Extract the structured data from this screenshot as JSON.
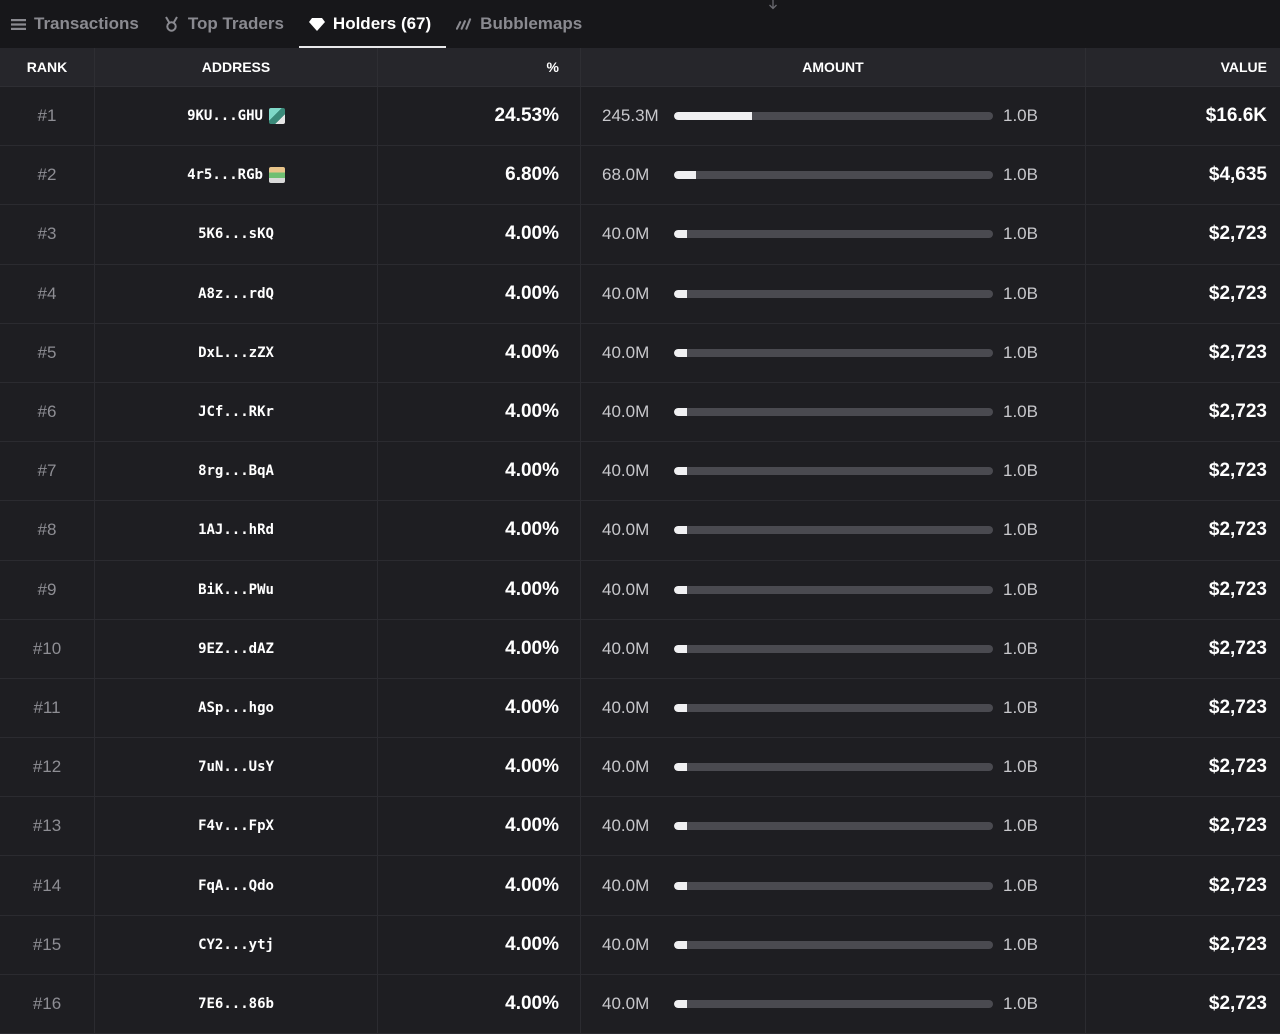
{
  "tabs": [
    {
      "label": "Transactions",
      "icon": "list-icon",
      "active": false
    },
    {
      "label": "Top Traders",
      "icon": "medal-icon",
      "active": false
    },
    {
      "label": "Holders (67)",
      "icon": "diamond-icon",
      "active": true
    },
    {
      "label": "Bubblemaps",
      "icon": "bubblemaps-icon",
      "active": false
    }
  ],
  "table": {
    "headers": {
      "rank": "RANK",
      "address": "ADDRESS",
      "percent": "%",
      "amount": "AMOUNT",
      "value": "VALUE"
    },
    "total_supply": "1.0B",
    "rows": [
      {
        "rank": "#1",
        "address": "9KU...GHU",
        "badge": "b1",
        "percent": "24.53%",
        "amount": "245.3M",
        "share": 0.2453,
        "value": "$16.6K"
      },
      {
        "rank": "#2",
        "address": "4r5...RGb",
        "badge": "b2",
        "percent": "6.80%",
        "amount": "68.0M",
        "share": 0.068,
        "value": "$4,635"
      },
      {
        "rank": "#3",
        "address": "5K6...sKQ",
        "badge": "",
        "percent": "4.00%",
        "amount": "40.0M",
        "share": 0.04,
        "value": "$2,723"
      },
      {
        "rank": "#4",
        "address": "A8z...rdQ",
        "badge": "",
        "percent": "4.00%",
        "amount": "40.0M",
        "share": 0.04,
        "value": "$2,723"
      },
      {
        "rank": "#5",
        "address": "DxL...zZX",
        "badge": "",
        "percent": "4.00%",
        "amount": "40.0M",
        "share": 0.04,
        "value": "$2,723"
      },
      {
        "rank": "#6",
        "address": "JCf...RKr",
        "badge": "",
        "percent": "4.00%",
        "amount": "40.0M",
        "share": 0.04,
        "value": "$2,723"
      },
      {
        "rank": "#7",
        "address": "8rg...BqA",
        "badge": "",
        "percent": "4.00%",
        "amount": "40.0M",
        "share": 0.04,
        "value": "$2,723"
      },
      {
        "rank": "#8",
        "address": "1AJ...hRd",
        "badge": "",
        "percent": "4.00%",
        "amount": "40.0M",
        "share": 0.04,
        "value": "$2,723"
      },
      {
        "rank": "#9",
        "address": "BiK...PWu",
        "badge": "",
        "percent": "4.00%",
        "amount": "40.0M",
        "share": 0.04,
        "value": "$2,723"
      },
      {
        "rank": "#10",
        "address": "9EZ...dAZ",
        "badge": "",
        "percent": "4.00%",
        "amount": "40.0M",
        "share": 0.04,
        "value": "$2,723"
      },
      {
        "rank": "#11",
        "address": "ASp...hgo",
        "badge": "",
        "percent": "4.00%",
        "amount": "40.0M",
        "share": 0.04,
        "value": "$2,723"
      },
      {
        "rank": "#12",
        "address": "7uN...UsY",
        "badge": "",
        "percent": "4.00%",
        "amount": "40.0M",
        "share": 0.04,
        "value": "$2,723"
      },
      {
        "rank": "#13",
        "address": "F4v...FpX",
        "badge": "",
        "percent": "4.00%",
        "amount": "40.0M",
        "share": 0.04,
        "value": "$2,723"
      },
      {
        "rank": "#14",
        "address": "FqA...Qdo",
        "badge": "",
        "percent": "4.00%",
        "amount": "40.0M",
        "share": 0.04,
        "value": "$2,723"
      },
      {
        "rank": "#15",
        "address": "CY2...ytj",
        "badge": "",
        "percent": "4.00%",
        "amount": "40.0M",
        "share": 0.04,
        "value": "$2,723"
      },
      {
        "rank": "#16",
        "address": "7E6...86b",
        "badge": "",
        "percent": "4.00%",
        "amount": "40.0M",
        "share": 0.04,
        "value": "$2,723"
      }
    ]
  }
}
